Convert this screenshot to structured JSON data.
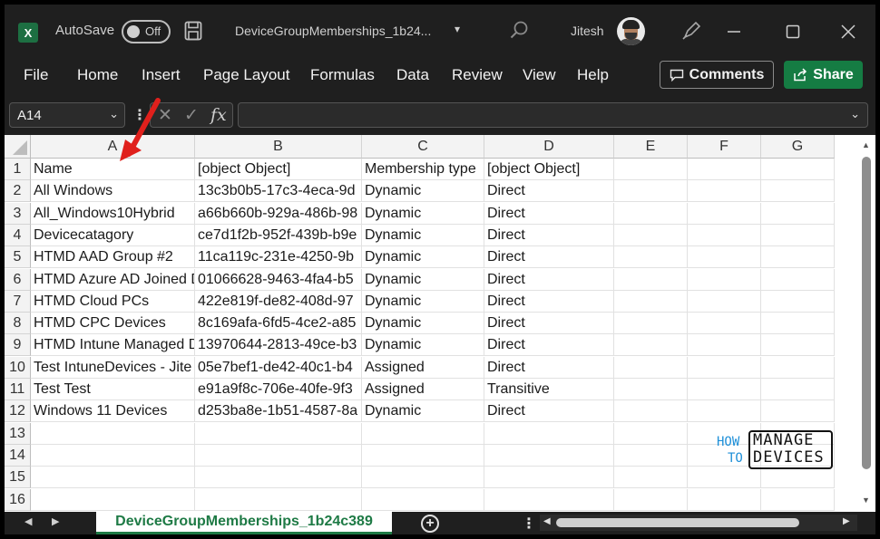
{
  "titlebar": {
    "app_logo": "X",
    "autosave_label": "AutoSave",
    "autosave_state": "Off",
    "filename": "DeviceGroupMemberships_1b24...",
    "user_name": "Jitesh",
    "icons": [
      "excel-logo-icon",
      "save-icon",
      "search-icon",
      "pen-icon",
      "minimize-icon",
      "maximize-icon",
      "close-icon"
    ]
  },
  "menu": {
    "items": [
      "File",
      "Home",
      "Insert",
      "Page Layout",
      "Formulas",
      "Data",
      "Review",
      "View",
      "Help"
    ],
    "comments_label": "Comments",
    "share_label": "Share"
  },
  "formula_bar": {
    "name_box": "A14",
    "fx_label": "fx",
    "formula_value": ""
  },
  "sheet": {
    "columns": [
      "A",
      "B",
      "C",
      "D",
      "E",
      "F",
      "G"
    ],
    "row_numbers": [
      "1",
      "2",
      "3",
      "4",
      "5",
      "6",
      "7",
      "8",
      "9",
      "10",
      "11",
      "12",
      "13",
      "14",
      "15",
      "16"
    ],
    "rows": [
      [
        "Name",
        "[object Object]",
        "Membership type",
        "[object Object]"
      ],
      [
        "All Windows",
        "13c3b0b5-17c3-4eca-9d",
        "Dynamic",
        "Direct"
      ],
      [
        "All_Windows10Hybrid",
        "a66b660b-929a-486b-98",
        "Dynamic",
        "Direct"
      ],
      [
        "Devicecatagory",
        "ce7d1f2b-952f-439b-b9e",
        "Dynamic",
        "Direct"
      ],
      [
        "HTMD AAD Group #2",
        "11ca119c-231e-4250-9b",
        "Dynamic",
        "Direct"
      ],
      [
        "HTMD Azure AD Joined D",
        "01066628-9463-4fa4-b5",
        "Dynamic",
        "Direct"
      ],
      [
        "HTMD Cloud PCs",
        "422e819f-de82-408d-97",
        "Dynamic",
        "Direct"
      ],
      [
        "HTMD CPC Devices",
        "8c169afa-6fd5-4ce2-a85",
        "Dynamic",
        "Direct"
      ],
      [
        "HTMD Intune Managed D",
        "13970644-2813-49ce-b3",
        "Dynamic",
        "Direct"
      ],
      [
        "Test IntuneDevices - Jite",
        "05e7bef1-de42-40c1-b4",
        "Assigned",
        "Direct"
      ],
      [
        "Test Test",
        "e91a9f8c-706e-40fe-9f3",
        "Assigned",
        "Transitive"
      ],
      [
        "Windows 11 Devices",
        "d253ba8e-1b51-4587-8a",
        "Dynamic",
        "Direct"
      ]
    ]
  },
  "sheet_tab": {
    "active_tab": "DeviceGroupMemberships_1b24c389",
    "add_sheet_label": "+"
  },
  "watermark": {
    "how": "HOW",
    "to": "TO",
    "manage": "MANAGE",
    "devices": "DEVICES"
  },
  "colors": {
    "accent_green": "#157c43",
    "window_bg": "#1f1f1f",
    "arrow_red": "#e0201c"
  }
}
